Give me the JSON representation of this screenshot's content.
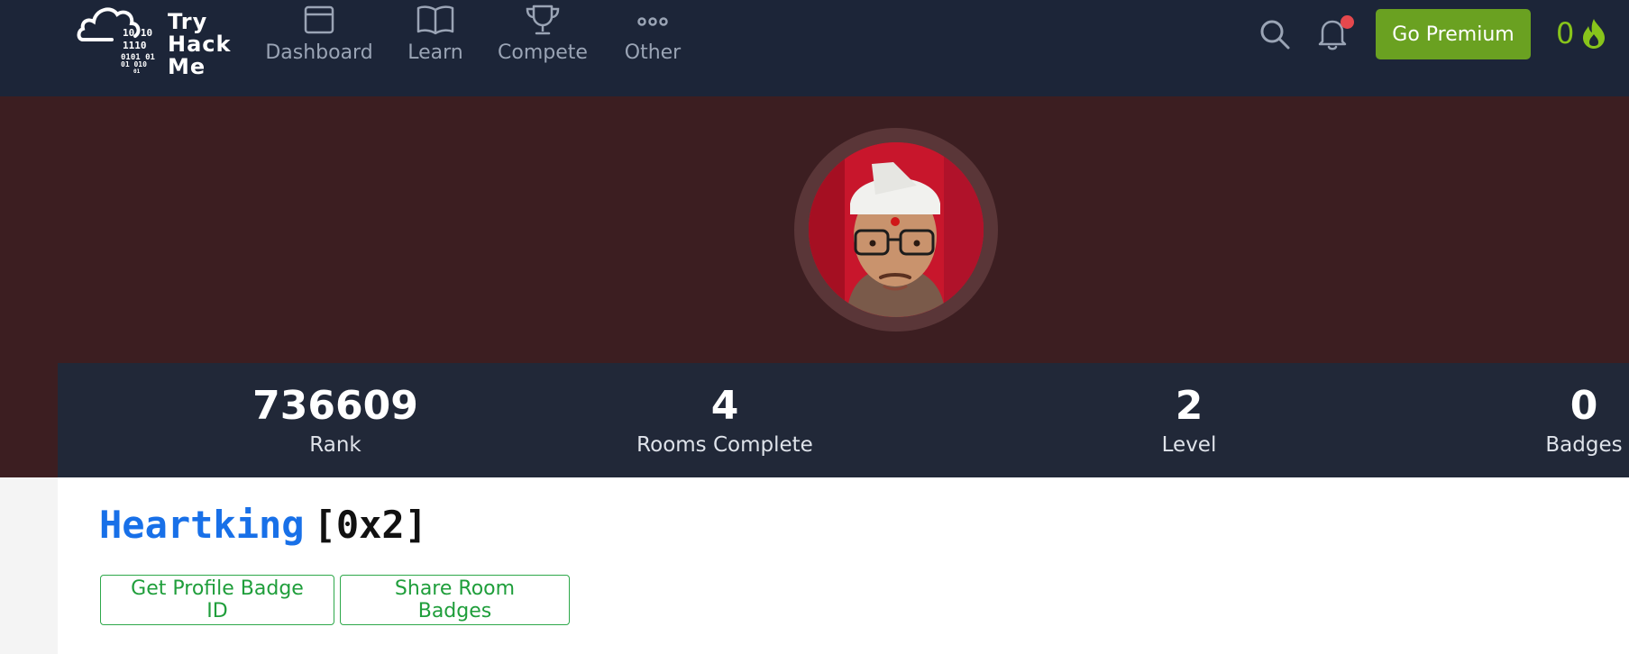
{
  "header": {
    "logo_lines": [
      "Try",
      "Hack",
      "Me"
    ],
    "logo_binary": [
      "10  10",
      "1110",
      "0101  01",
      "01  010",
      "01"
    ],
    "nav": [
      {
        "label": "Dashboard",
        "icon": "browser-window-icon"
      },
      {
        "label": "Learn",
        "icon": "book-icon"
      },
      {
        "label": "Compete",
        "icon": "trophy-icon"
      },
      {
        "label": "Other",
        "icon": "more-dots-icon"
      }
    ],
    "premium_label": "Go Premium",
    "streak_count": "0",
    "has_notification": true
  },
  "profile": {
    "avatar_icon": "user-avatar-photo",
    "stats": [
      {
        "value": "736609",
        "label": "Rank"
      },
      {
        "value": "4",
        "label": "Rooms Complete"
      },
      {
        "value": "2",
        "label": "Level"
      },
      {
        "value": "0",
        "label": "Badges"
      }
    ],
    "username": "Heartking",
    "level_tag": "[0x2]",
    "buttons": {
      "badge_id": "Get Profile Badge ID",
      "share_badges": "Share Room Badges"
    }
  },
  "colors": {
    "nav_bg": "#1c2538",
    "hero_bg": "#3c1e21",
    "stats_bg": "#212838",
    "premium": "#6aa121",
    "streak": "#88c41b",
    "username": "#1870e8",
    "outline_btn": "#1f9e3b",
    "notification_dot": "#e5484d"
  }
}
